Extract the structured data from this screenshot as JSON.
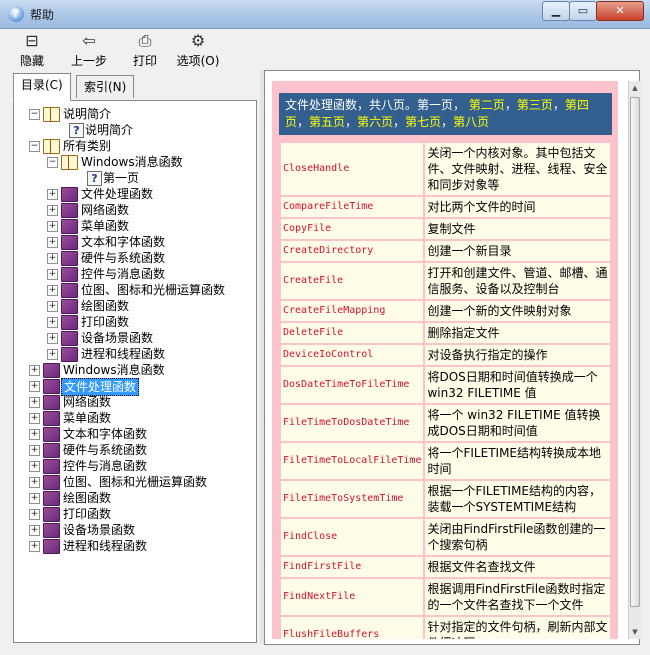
{
  "window": {
    "title": "帮助",
    "min_label": "▁",
    "max_label": "▭",
    "close_label": "✕"
  },
  "toolbar": {
    "hide": "隐藏",
    "back": "上一步",
    "print": "打印",
    "options": "选项(O)"
  },
  "tabs": {
    "contents": "目录(C)",
    "index": "索引(N)"
  },
  "tree": {
    "intro": "说明简介",
    "intro_page": "说明简介",
    "all": "所有类别",
    "win_msg": "Windows消息函数",
    "first_page": "第一页",
    "sub": [
      "文件处理函数",
      "网络函数",
      "菜单函数",
      "文本和字体函数",
      "硬件与系统函数",
      "控件与消息函数",
      "位图、图标和光栅运算函数",
      "绘图函数",
      "打印函数",
      "设备场景函数",
      "进程和线程函数"
    ],
    "top": [
      "Windows消息函数",
      "文件处理函数",
      "网络函数",
      "菜单函数",
      "文本和字体函数",
      "硬件与系统函数",
      "控件与消息函数",
      "位图、图标和光栅运算函数",
      "绘图函数",
      "打印函数",
      "设备场景函数",
      "进程和线程函数"
    ],
    "selected": "文件处理函数"
  },
  "content": {
    "header_current": "文件处理函数，共八页。第一页，",
    "header_links": [
      "第二页",
      "第三页",
      "第四页",
      "第五页",
      "第六页",
      "第七页",
      "第八页"
    ],
    "rows": [
      {
        "name": "CloseHandle",
        "desc": "关闭一个内核对象。其中包括文件、文件映射、进程、线程、安全和同步对象等"
      },
      {
        "name": "CompareFileTime",
        "desc": "对比两个文件的时间"
      },
      {
        "name": "CopyFile",
        "desc": "复制文件"
      },
      {
        "name": "CreateDirectory",
        "desc": "创建一个新目录"
      },
      {
        "name": "CreateFile",
        "desc": "打开和创建文件、管道、邮槽、通信服务、设备以及控制台"
      },
      {
        "name": "CreateFileMapping",
        "desc": "创建一个新的文件映射对象"
      },
      {
        "name": "DeleteFile",
        "desc": "删除指定文件"
      },
      {
        "name": "DeviceIoControl",
        "desc": "对设备执行指定的操作"
      },
      {
        "name": "DosDateTimeToFileTime",
        "desc": "将DOS日期和时间值转换成一个 win32 FILETIME 值"
      },
      {
        "name": "FileTimeToDosDateTime",
        "desc": "将一个 win32  FILETIME 值转换成DOS日期和时间值"
      },
      {
        "name": "FileTimeToLocalFileTime",
        "desc": "将一个FILETIME结构转换成本地时间"
      },
      {
        "name": "FileTimeToSystemTime",
        "desc": "根据一个FILETIME结构的内容，装载一个SYSTEMTIME结构"
      },
      {
        "name": "FindClose",
        "desc": "关闭由FindFirstFile函数创建的一个搜索句柄"
      },
      {
        "name": "FindFirstFile",
        "desc": "根据文件名查找文件"
      },
      {
        "name": "FindNextFile",
        "desc": "根据调用FindFirstFile函数时指定的一个文件名查找下一个文件"
      },
      {
        "name": "FlushFileBuffers",
        "desc": "针对指定的文件句柄，刷新内部文件缓冲区"
      }
    ]
  },
  "colors": {
    "header_bg": "#335f8e",
    "link": "#ffff00",
    "func_name": "#d1122d",
    "panel": "#fcc3cc",
    "cell": "#fffce8"
  }
}
